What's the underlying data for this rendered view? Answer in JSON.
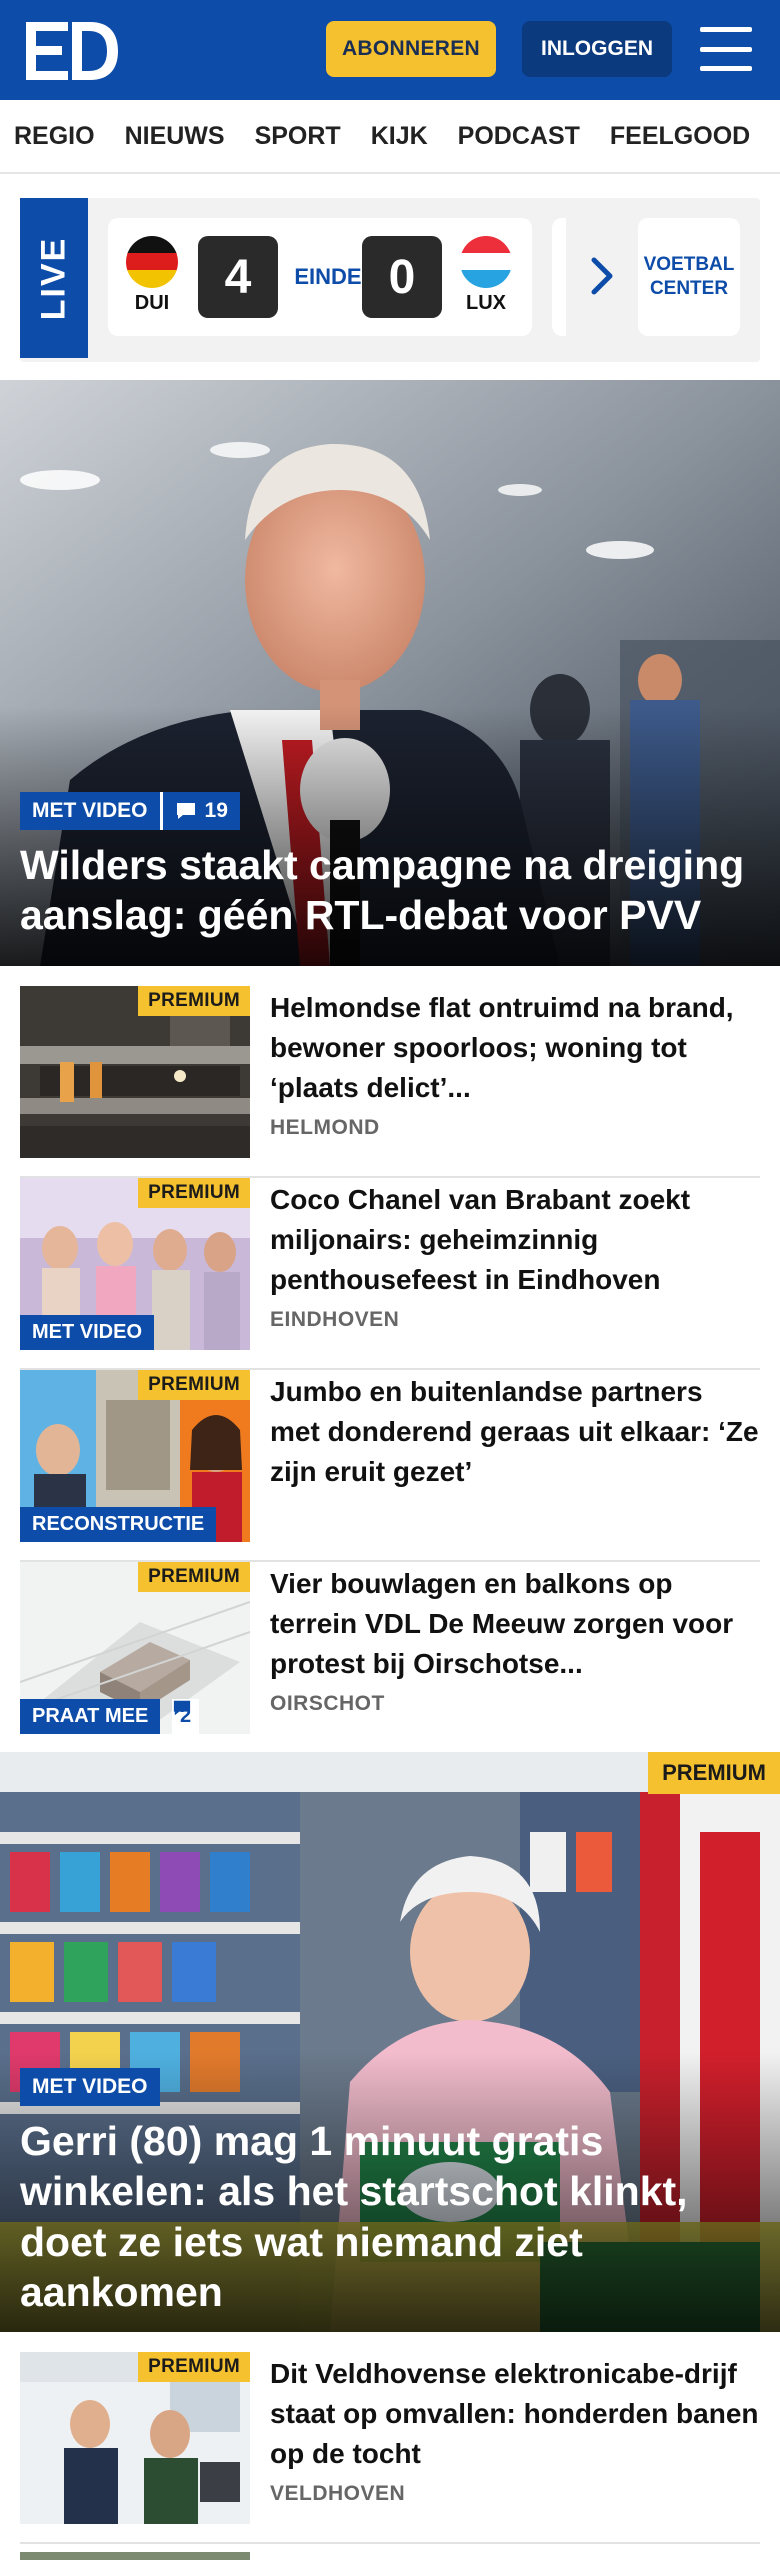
{
  "header": {
    "logo_text": "ED",
    "subscribe_label": "ABONNEREN",
    "login_label": "INLOGGEN",
    "menu_icon": "hamburger-icon",
    "brand_color": "#0d4ca8",
    "accent_color": "#f5c12f"
  },
  "nav": {
    "items": [
      "REGIO",
      "NIEUWS",
      "SPORT",
      "KIJK",
      "PODCAST",
      "FEELGOOD"
    ]
  },
  "live": {
    "label": "LIVE",
    "match": {
      "home_code": "DUI",
      "home_score": "4",
      "status": "EINDE",
      "away_score": "0",
      "away_code": "LUX"
    },
    "next_icon": "chevron-right-icon",
    "center_label": "VOETBAL CENTER"
  },
  "hero": {
    "badge": "MET VIDEO",
    "comments": "19",
    "title": "Wilders staakt campagne na dreiging aanslag: géén RTL-debat voor PVV"
  },
  "articles": [
    {
      "premium": "PREMIUM",
      "badge": "",
      "comments": "",
      "title": "Helmondse flat ontruimd na brand, bewoner spoorloos; woning tot ‘plaats delict’...",
      "location": "HELMOND"
    },
    {
      "premium": "PREMIUM",
      "badge": "MET VIDEO",
      "comments": "",
      "title": "Coco Chanel van Brabant zoekt miljonairs: geheimzinnig penthousefeest in Eindhoven",
      "location": "EINDHOVEN"
    },
    {
      "premium": "PREMIUM",
      "badge": "RECONSTRUCTIE",
      "comments": "",
      "title": "Jumbo en buitenlandse partners met donderend geraas uit elkaar: ‘Ze zijn eruit gezet’",
      "location": ""
    },
    {
      "premium": "PREMIUM",
      "badge": "PRAAT MEE",
      "comments": "2",
      "title": "Vier bouwlagen en balkons op terrein VDL De Meeuw zorgen voor protest bij Oirschotse...",
      "location": "OIRSCHOT"
    }
  ],
  "featured": {
    "premium": "PREMIUM",
    "badge": "MET VIDEO",
    "title": "Gerri (80) mag 1 minuut gratis winkelen: als het startschot klinkt, doet ze iets wat niemand ziet aankomen"
  },
  "article_after": {
    "premium": "PREMIUM",
    "title": "Dit Veldhovense elektronicabe-drijf staat op omvallen: honderden banen op de tocht",
    "location": "VELDHOVEN"
  }
}
